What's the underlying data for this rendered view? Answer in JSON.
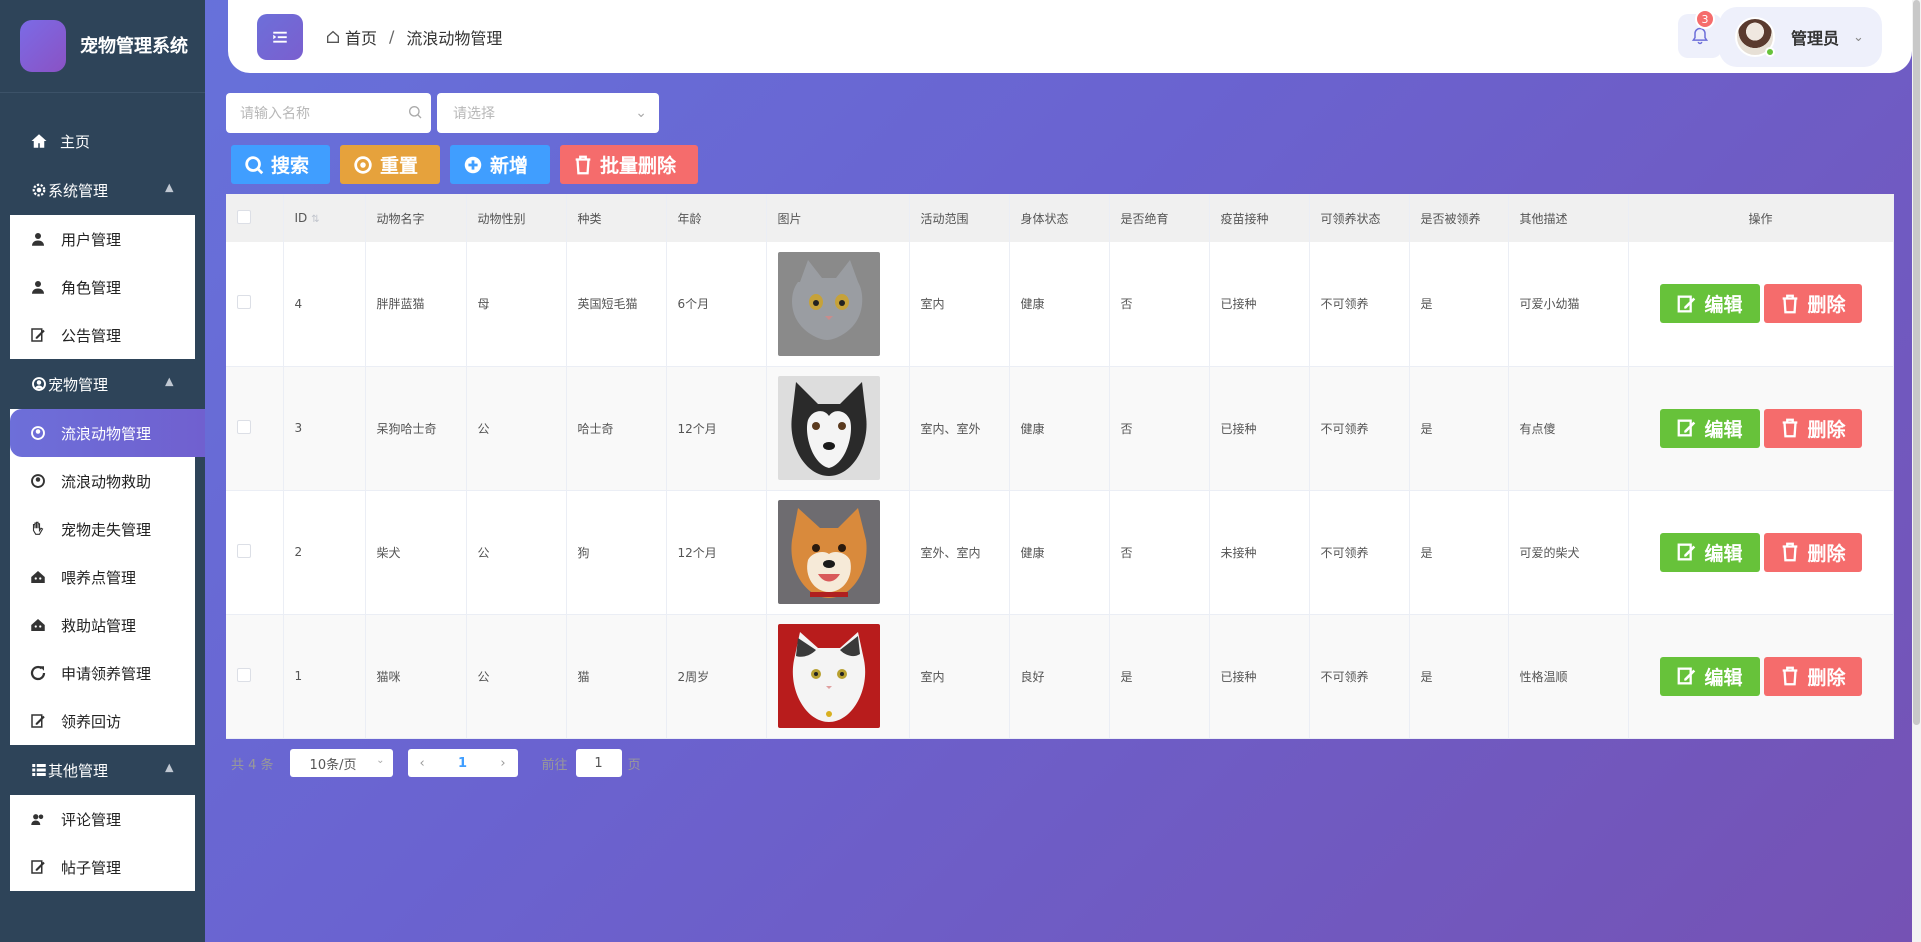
{
  "sidebar": {
    "brand": "宠物管理系统",
    "home": "主页",
    "groups": [
      {
        "label": "系统管理",
        "items": [
          "用户管理",
          "角色管理",
          "公告管理"
        ]
      },
      {
        "label": "宠物管理",
        "items": [
          "流浪动物管理",
          "流浪动物救助",
          "宠物走失管理",
          "喂养点管理",
          "救助站管理",
          "申请领养管理",
          "领养回访"
        ]
      },
      {
        "label": "其他管理",
        "items": [
          "评论管理",
          "帖子管理"
        ]
      }
    ],
    "active_item": "流浪动物管理"
  },
  "header": {
    "breadcrumb": [
      "首页",
      "流浪动物管理"
    ],
    "breadcrumb_sep": "/",
    "notification_count": "3",
    "user_name": "管理员"
  },
  "filters": {
    "name_placeholder": "请输入名称",
    "select_placeholder": "请选择"
  },
  "actions": {
    "search": "搜索",
    "reset": "重置",
    "add": "新增",
    "batch_delete": "批量删除"
  },
  "table": {
    "columns": [
      "ID",
      "动物名字",
      "动物性别",
      "种类",
      "年龄",
      "图片",
      "活动范围",
      "身体状态",
      "是否绝育",
      "疫苗接种",
      "可领养状态",
      "是否被领养",
      "其他描述",
      "操作"
    ],
    "rows": [
      {
        "id": "4",
        "name": "胖胖蓝猫",
        "gender": "母",
        "species": "英国短毛猫",
        "age": "6个月",
        "image": "gray-cat",
        "range": "室内",
        "health": "健康",
        "neutered": "否",
        "vaccine": "已接种",
        "adoptable": "不可领养",
        "adopted": "是",
        "desc": "可爱小幼猫"
      },
      {
        "id": "3",
        "name": "呆狗哈士奇",
        "gender": "公",
        "species": "哈士奇",
        "age": "12个月",
        "image": "husky",
        "range": "室内、室外",
        "health": "健康",
        "neutered": "否",
        "vaccine": "已接种",
        "adoptable": "不可领养",
        "adopted": "是",
        "desc": "有点傻"
      },
      {
        "id": "2",
        "name": "柴犬",
        "gender": "公",
        "species": "狗",
        "age": "12个月",
        "image": "shiba",
        "range": "室外、室内",
        "health": "健康",
        "neutered": "否",
        "vaccine": "未接种",
        "adoptable": "不可领养",
        "adopted": "是",
        "desc": "可爱的柴犬"
      },
      {
        "id": "1",
        "name": "猫咪",
        "gender": "公",
        "species": "猫",
        "age": "2周岁",
        "image": "white-cat",
        "range": "室内",
        "health": "良好",
        "neutered": "是",
        "vaccine": "已接种",
        "adoptable": "不可领养",
        "adopted": "是",
        "desc": "性格温顺"
      }
    ],
    "edit_label": "编辑",
    "delete_label": "删除"
  },
  "pagination": {
    "total": "共 4 条",
    "page_size": "10条/页",
    "current_page": "1",
    "goto_label": "前往",
    "goto_value": "1",
    "page_unit": "页"
  },
  "colors": {
    "sidebar_bg": "#2e4459",
    "accent": "#6d6fd9",
    "primary": "#409eff",
    "warning": "#e6a23c",
    "success": "#67c23a",
    "danger": "#f56c6c"
  }
}
